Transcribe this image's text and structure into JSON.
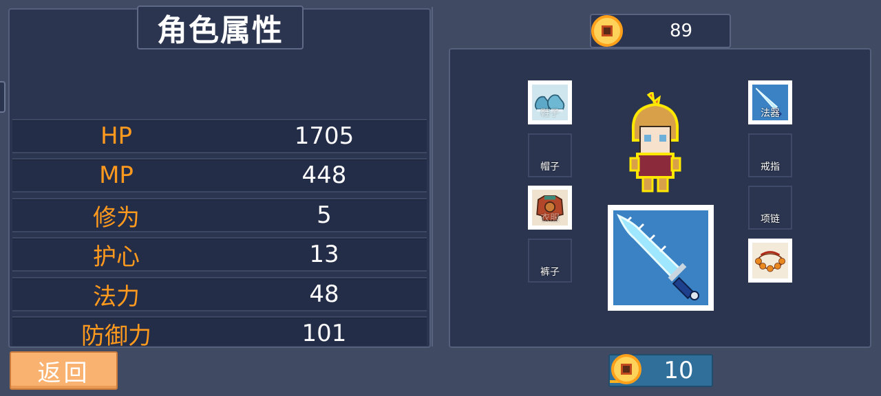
{
  "title": "角色属性",
  "stats": [
    {
      "label": "HP",
      "value": "1705"
    },
    {
      "label": "MP",
      "value": "448"
    },
    {
      "label": "修为",
      "value": "5"
    },
    {
      "label": "护心",
      "value": "13"
    },
    {
      "label": "法力",
      "value": "48"
    },
    {
      "label": "防御力",
      "value": "101"
    }
  ],
  "back_button": "返回",
  "currency_top": "89",
  "currency_bottom": "10",
  "equipment": {
    "shoes": {
      "label": "鞋子",
      "icon": "shoes-icon"
    },
    "hat": {
      "label": "帽子"
    },
    "armor": {
      "label": "衣服",
      "icon": "armor-icon"
    },
    "pants": {
      "label": "裤子"
    },
    "weapon": {
      "label": "法器",
      "icon": "ice-sword-icon"
    },
    "ring": {
      "label": "戒指"
    },
    "necklace": {
      "label": "项链"
    },
    "bracelet": {
      "icon": "bead-bracelet-icon"
    }
  },
  "colors": {
    "background": "#404a63",
    "panel": "#2b3550",
    "stat_label": "#ff9a1e",
    "button": "#f9b270",
    "coin": "#ffd35a"
  }
}
